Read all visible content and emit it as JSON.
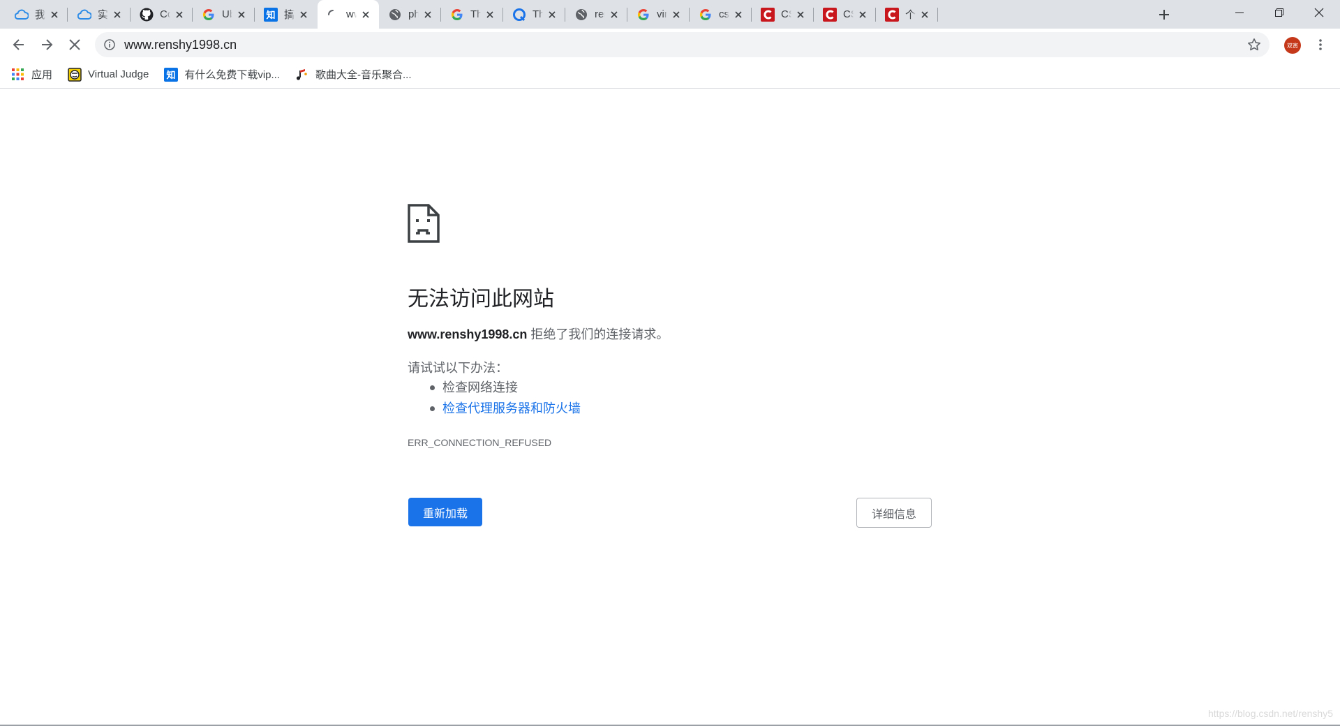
{
  "tabs": [
    {
      "title": "我的",
      "icon": "cloud-icon",
      "active": false
    },
    {
      "title": "实例",
      "icon": "cloud-icon",
      "active": false
    },
    {
      "title": "Con",
      "icon": "github-icon",
      "active": false
    },
    {
      "title": "Ubu",
      "icon": "google-icon",
      "active": false
    },
    {
      "title": "搞一",
      "icon": "zhihu-icon",
      "active": false
    },
    {
      "title": "www",
      "icon": "loading-spinner-icon",
      "active": true
    },
    {
      "title": "php",
      "icon": "globe-icon",
      "active": false
    },
    {
      "title": "The",
      "icon": "google-icon",
      "active": false
    },
    {
      "title": "The",
      "icon": "blue-q-icon",
      "active": false
    },
    {
      "title": "rens",
      "icon": "globe-icon",
      "active": false
    },
    {
      "title": "vim",
      "icon": "google-icon",
      "active": false
    },
    {
      "title": "csdr",
      "icon": "google-icon",
      "active": false
    },
    {
      "title": "CSD",
      "icon": "csdn-icon",
      "active": false
    },
    {
      "title": "CSD",
      "icon": "csdn-icon",
      "active": false
    },
    {
      "title": "个人",
      "icon": "csdn-icon",
      "active": false
    }
  ],
  "toolbar": {
    "url": "www.renshy1998.cn",
    "avatar_text": "双寅"
  },
  "bookmarks": [
    {
      "label": "应用",
      "icon": "apps-grid-icon"
    },
    {
      "label": "Virtual Judge",
      "icon": "virtual-judge-icon"
    },
    {
      "label": "有什么免费下载vip...",
      "icon": "zhihu-icon"
    },
    {
      "label": "歌曲大全-音乐聚合...",
      "icon": "music-note-icon"
    }
  ],
  "error": {
    "title": "无法访问此网站",
    "host": "www.renshy1998.cn",
    "desc_rest": " 拒绝了我们的连接请求。",
    "suggest_label": "请试试以下办法：",
    "suggestions": [
      {
        "text": "检查网络连接",
        "link": false
      },
      {
        "text": "检查代理服务器和防火墙",
        "link": true
      }
    ],
    "code": "ERR_CONNECTION_REFUSED",
    "reload_label": "重新加载",
    "details_label": "详细信息"
  },
  "watermark": "https://blog.csdn.net/renshy5",
  "colors": {
    "accent": "#1a73e8",
    "tabstrip": "#dee1e6",
    "omnibox": "#f1f3f4",
    "csdn_red": "#c9171e",
    "zhihu_blue": "#0a74e6"
  }
}
